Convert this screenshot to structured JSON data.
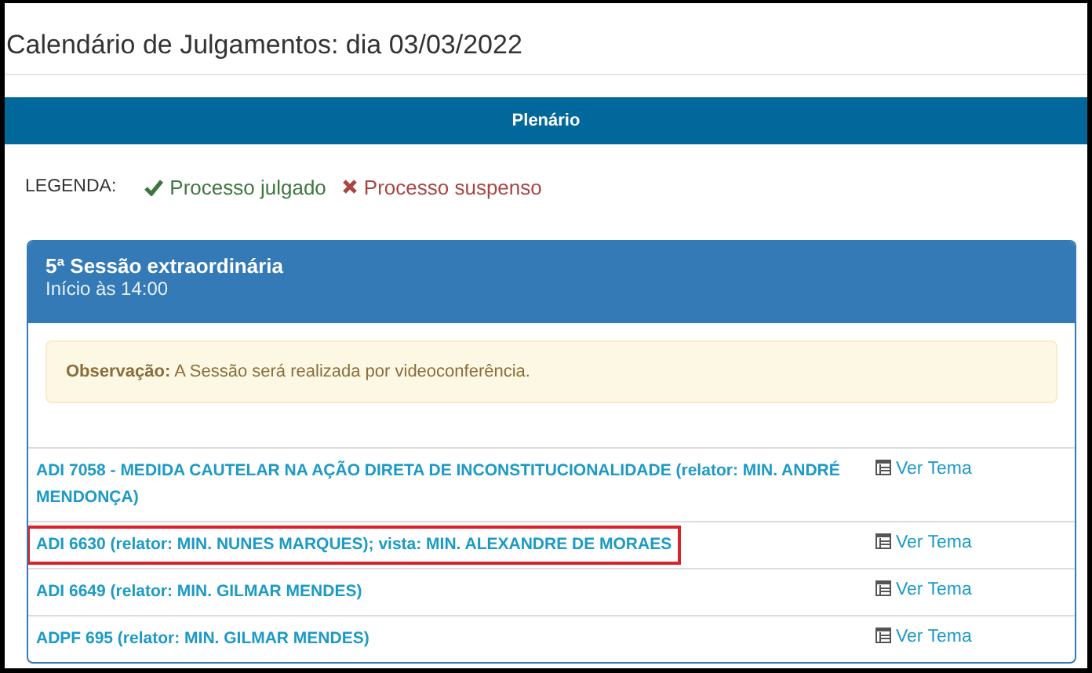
{
  "window": {
    "title": "Calendário de Julgamentos: dia 03/03/2022"
  },
  "tab_bar": {
    "label": "Plenário"
  },
  "legend": {
    "label": "LEGENDA:",
    "items": [
      {
        "kind": "judged",
        "label": "Processo julgado"
      },
      {
        "kind": "suspended",
        "label": "Processo suspenso"
      }
    ]
  },
  "session": {
    "title": "5ª Sessão extraordinária",
    "start": "Início às 14:00",
    "note": {
      "label": "Observação:",
      "text": "A Sessão será realizada por videoconferência."
    },
    "cases": [
      {
        "title": "ADI 7058 - MEDIDA CAUTELAR NA AÇÃO DIRETA DE INCONSTITUCIONALIDADE (relator: MIN. ANDRÉ MENDONÇA)",
        "link": "Ver Tema",
        "highlighted": false
      },
      {
        "title": "ADI 6630 (relator: MIN. NUNES MARQUES); vista: MIN. ALEXANDRE DE MORAES",
        "link": "Ver Tema",
        "highlighted": true
      },
      {
        "title": "ADI 6649 (relator: MIN. GILMAR MENDES)",
        "link": "Ver Tema",
        "highlighted": false
      },
      {
        "title": "ADPF 695 (relator: MIN. GILMAR MENDES)",
        "link": "Ver Tema",
        "highlighted": false
      }
    ]
  }
}
